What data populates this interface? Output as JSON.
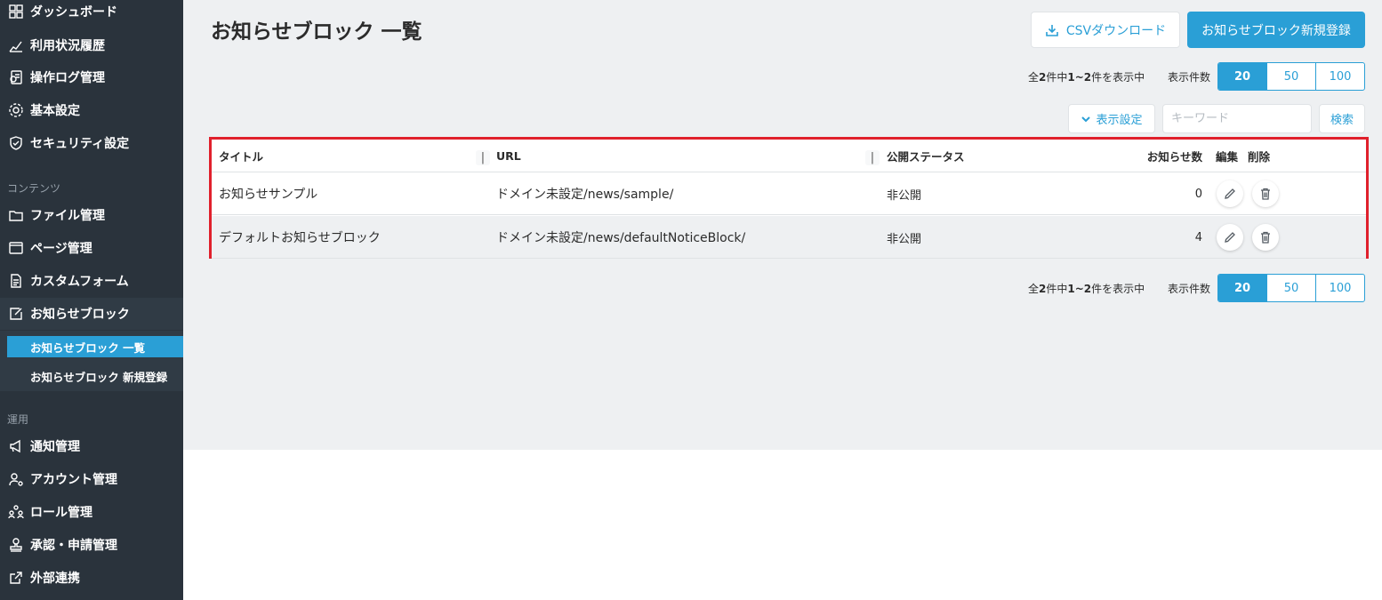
{
  "sidebar": {
    "items_top": [
      {
        "label": "ダッシュボード",
        "icon": "dashboard-icon"
      },
      {
        "label": "利用状況履歴",
        "icon": "chart-icon"
      },
      {
        "label": "操作ログ管理",
        "icon": "log-icon"
      },
      {
        "label": "基本設定",
        "icon": "gear-icon"
      },
      {
        "label": "セキュリティ設定",
        "icon": "shield-icon"
      }
    ],
    "section_contents": "コンテンツ",
    "items_contents": [
      {
        "label": "ファイル管理",
        "icon": "folder-icon"
      },
      {
        "label": "ページ管理",
        "icon": "page-icon"
      },
      {
        "label": "カスタムフォーム",
        "icon": "form-icon"
      },
      {
        "label": "お知らせブロック",
        "icon": "edit-icon"
      }
    ],
    "sub_items": [
      {
        "label": "お知らせブロック 一覧"
      },
      {
        "label": "お知らせブロック 新規登録"
      }
    ],
    "section_operation": "運用",
    "items_operation": [
      {
        "label": "通知管理",
        "icon": "megaphone-icon"
      },
      {
        "label": "アカウント管理",
        "icon": "user-gear-icon"
      },
      {
        "label": "ロール管理",
        "icon": "role-icon"
      },
      {
        "label": "承認・申請管理",
        "icon": "stamp-icon"
      },
      {
        "label": "外部連携",
        "icon": "external-link-icon"
      }
    ]
  },
  "header": {
    "title": "お知らせブロック 一覧",
    "csv_button": "CSVダウンロード",
    "new_button": "お知らせブロック新規登録"
  },
  "pagination": {
    "count_prefix": "全",
    "total": "2",
    "count_mid1": "件中",
    "range": "1~2",
    "count_suffix": "件を表示中",
    "per_page_label": "表示件数",
    "per_page_options": [
      "20",
      "50",
      "100"
    ],
    "selected": "20"
  },
  "filters": {
    "display_settings": "表示設定",
    "keyword_placeholder": "キーワード",
    "search_button": "検索"
  },
  "table": {
    "headers": {
      "title": "タイトル",
      "url": "URL",
      "status": "公開ステータス",
      "count": "お知らせ数",
      "edit": "編集",
      "delete": "削除"
    },
    "rows": [
      {
        "title": "お知らせサンプル",
        "url": "ドメイン未設定/news/sample/",
        "status": "非公開",
        "count": "0"
      },
      {
        "title": "デフォルトお知らせブロック",
        "url": "ドメイン未設定/news/defaultNoticeBlock/",
        "status": "非公開",
        "count": "4"
      }
    ]
  },
  "colors": {
    "accent": "#2a9fd6",
    "sidebar_bg": "#2a333c",
    "highlight_border": "#e0202c"
  }
}
